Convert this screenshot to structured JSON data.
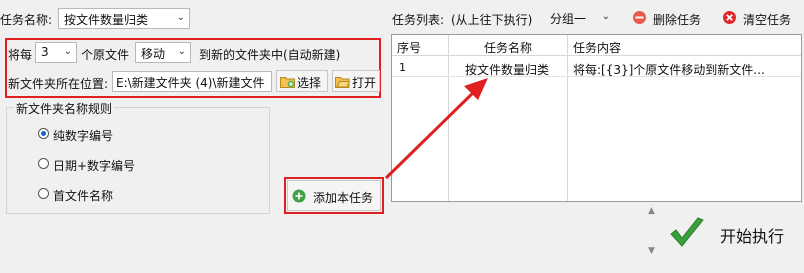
{
  "task_name": {
    "label": "任务名称:",
    "value": "按文件数量归类"
  },
  "task_list": {
    "label": "任务列表:",
    "order_note": "(从上往下执行)",
    "group_value": "分组一",
    "delete_button": "删除任务",
    "clear_button": "清空任务",
    "headers": {
      "index": "序号",
      "name": "任务名称",
      "content": "任务内容"
    },
    "rows": [
      {
        "index": "1",
        "name": "按文件数量归类",
        "content": "将每:[{3}]个原文件移动到新文件..."
      }
    ]
  },
  "rule": {
    "prefix": "将每",
    "count_value": "3",
    "middle": "个原文件",
    "action_value": "移动",
    "suffix": "到新的文件夹中(自动新建)"
  },
  "location": {
    "label": "新文件夹所在位置:",
    "path_value": "E:\\新建文件夹 (4)\\新建文件",
    "select_button": "选择",
    "open_button": "打开"
  },
  "naming": {
    "title": "新文件夹名称规则",
    "options": [
      "纯数字编号",
      "日期+数字编号",
      "首文件名称"
    ],
    "selected_index": 0
  },
  "add_task_button": "添加本任务",
  "start_button": "开始执行",
  "colors": {
    "highlight": "#e02020",
    "accent": "#1a5fd0",
    "start_check": "#3aa23a"
  }
}
